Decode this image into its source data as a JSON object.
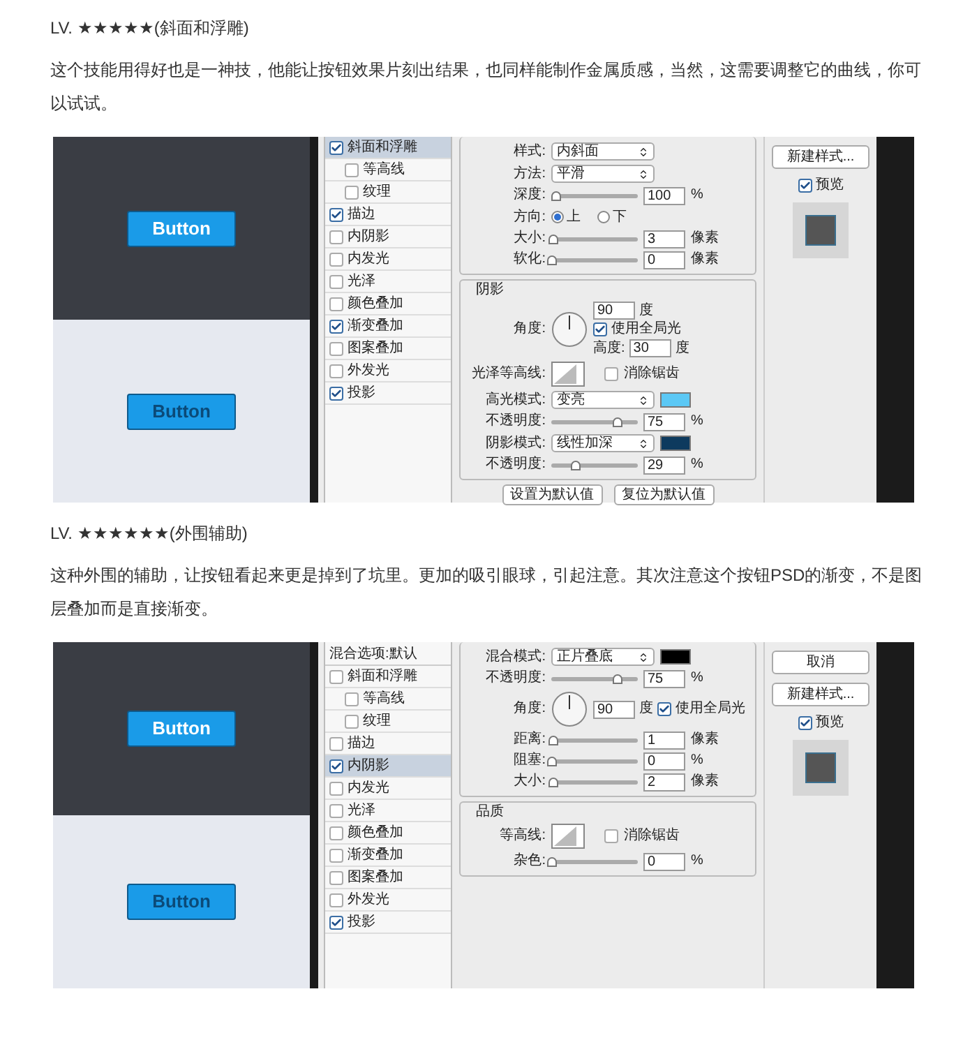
{
  "sections": [
    {
      "heading": "LV. ★★★★★(斜面和浮雕)",
      "paragraph": "这个技能用得好也是一神技，他能让按钮效果片刻出结果，也同样能制作金属质感，当然，这需要调整它的曲线，你可以试试。",
      "figure": {
        "sample_buttons": [
          {
            "label": "Button",
            "kind": "on_dark"
          },
          {
            "label": "Button",
            "kind": "on_light"
          }
        ],
        "dialog": {
          "sidebar": [
            {
              "label": "斜面和浮雕",
              "checked": true,
              "selected": true,
              "children": [
                {
                  "label": "等高线",
                  "checked": false,
                  "selected": false
                },
                {
                  "label": "纹理",
                  "checked": false,
                  "selected": false
                }
              ]
            },
            {
              "label": "描边",
              "checked": true,
              "selected": false
            },
            {
              "label": "内阴影",
              "checked": false,
              "selected": false
            },
            {
              "label": "内发光",
              "checked": false,
              "selected": false
            },
            {
              "label": "光泽",
              "checked": false,
              "selected": false
            },
            {
              "label": "颜色叠加",
              "checked": false,
              "selected": false
            },
            {
              "label": "渐变叠加",
              "checked": true,
              "selected": false
            },
            {
              "label": "图案叠加",
              "checked": false,
              "selected": false
            },
            {
              "label": "外发光",
              "checked": false,
              "selected": false
            },
            {
              "label": "投影",
              "checked": true,
              "selected": false
            }
          ],
          "groups": [
            {
              "rows": [
                {
                  "kind": "select",
                  "label": "样式:",
                  "value": "内斜面"
                },
                {
                  "kind": "select",
                  "label": "方法:",
                  "value": "平滑"
                },
                {
                  "kind": "slider",
                  "label": "深度:",
                  "level": 0.05,
                  "value": "100",
                  "unit": "%"
                },
                {
                  "kind": "radio",
                  "label": "方向:",
                  "options": [
                    {
                      "label": "上",
                      "selected": true
                    },
                    {
                      "label": "下",
                      "selected": false
                    }
                  ]
                },
                {
                  "kind": "slider",
                  "label": "大小:",
                  "level": 0.02,
                  "value": "3",
                  "unit": "像素"
                },
                {
                  "kind": "slider",
                  "label": "软化:",
                  "level": 0,
                  "value": "0",
                  "unit": "像素"
                }
              ]
            },
            {
              "title": "阴影",
              "rows": [
                {
                  "kind": "angle",
                  "label": "角度:",
                  "value": "90",
                  "unit": "度",
                  "checkbox": {
                    "label": "使用全局光",
                    "checked": true
                  },
                  "altitude": {
                    "label": "高度:",
                    "value": "30",
                    "unit": "度"
                  }
                },
                {
                  "kind": "contour",
                  "label": "光泽等高线:",
                  "checkbox": {
                    "label": "消除锯齿",
                    "checked": false
                  }
                },
                {
                  "kind": "select",
                  "label": "高光模式:",
                  "value": "变亮",
                  "color": "#5bc8f5"
                },
                {
                  "kind": "slider",
                  "label": "不透明度:",
                  "level": 0.75,
                  "value": "75",
                  "unit": "%"
                },
                {
                  "kind": "select",
                  "label": "阴影模式:",
                  "value": "线性加深",
                  "color": "#0d3a5e"
                },
                {
                  "kind": "slider",
                  "label": "不透明度:",
                  "level": 0.28,
                  "value": "29",
                  "unit": "%"
                }
              ]
            }
          ],
          "buttons": [
            "设置为默认值",
            "复位为默认值"
          ],
          "side_buttons": [
            "新建样式..."
          ],
          "preview": {
            "label": "预览",
            "checked": true
          }
        }
      }
    },
    {
      "heading": "LV. ★★★★★★(外围辅助)",
      "paragraph": "这种外围的辅助，让按钮看起来更是掉到了坑里。更加的吸引眼球，引起注意。其次注意这个按钮PSD的渐变，不是图层叠加而是直接渐变。",
      "figure": {
        "sample_buttons": [
          {
            "label": "Button",
            "kind": "on_dark"
          },
          {
            "label": "Button",
            "kind": "on_light"
          }
        ],
        "dialog": {
          "sidebar_header": "混合选项:默认",
          "sidebar": [
            {
              "label": "斜面和浮雕",
              "checked": false,
              "selected": false,
              "children": [
                {
                  "label": "等高线",
                  "checked": false,
                  "selected": false
                },
                {
                  "label": "纹理",
                  "checked": false,
                  "selected": false
                }
              ]
            },
            {
              "label": "描边",
              "checked": false,
              "selected": false
            },
            {
              "label": "内阴影",
              "checked": true,
              "selected": true
            },
            {
              "label": "内发光",
              "checked": false,
              "selected": false
            },
            {
              "label": "光泽",
              "checked": false,
              "selected": false
            },
            {
              "label": "颜色叠加",
              "checked": false,
              "selected": false
            },
            {
              "label": "渐变叠加",
              "checked": false,
              "selected": false
            },
            {
              "label": "图案叠加",
              "checked": false,
              "selected": false
            },
            {
              "label": "外发光",
              "checked": false,
              "selected": false
            },
            {
              "label": "投影",
              "checked": true,
              "selected": false
            }
          ],
          "groups": [
            {
              "rows": [
                {
                  "kind": "select",
                  "label": "混合模式:",
                  "value": "正片叠底",
                  "color": "#000000"
                },
                {
                  "kind": "slider",
                  "label": "不透明度:",
                  "level": 0.75,
                  "value": "75",
                  "unit": "%"
                },
                {
                  "kind": "angle",
                  "label": "角度:",
                  "value": "90",
                  "unit": "度",
                  "checkbox": {
                    "label": "使用全局光",
                    "checked": true
                  }
                },
                {
                  "kind": "slider",
                  "label": "距离:",
                  "level": 0.02,
                  "value": "1",
                  "unit": "像素"
                },
                {
                  "kind": "slider",
                  "label": "阻塞:",
                  "level": 0,
                  "value": "0",
                  "unit": "%"
                },
                {
                  "kind": "slider",
                  "label": "大小:",
                  "level": 0.02,
                  "value": "2",
                  "unit": "像素"
                }
              ]
            },
            {
              "title": "品质",
              "rows": [
                {
                  "kind": "contour",
                  "label": "等高线:",
                  "checkbox": {
                    "label": "消除锯齿",
                    "checked": false
                  }
                },
                {
                  "kind": "slider",
                  "label": "杂色:",
                  "level": 0,
                  "value": "0",
                  "unit": "%"
                }
              ]
            }
          ],
          "side_buttons": [
            "取消",
            "新建样式..."
          ],
          "preview": {
            "label": "预览",
            "checked": true
          }
        }
      }
    }
  ]
}
